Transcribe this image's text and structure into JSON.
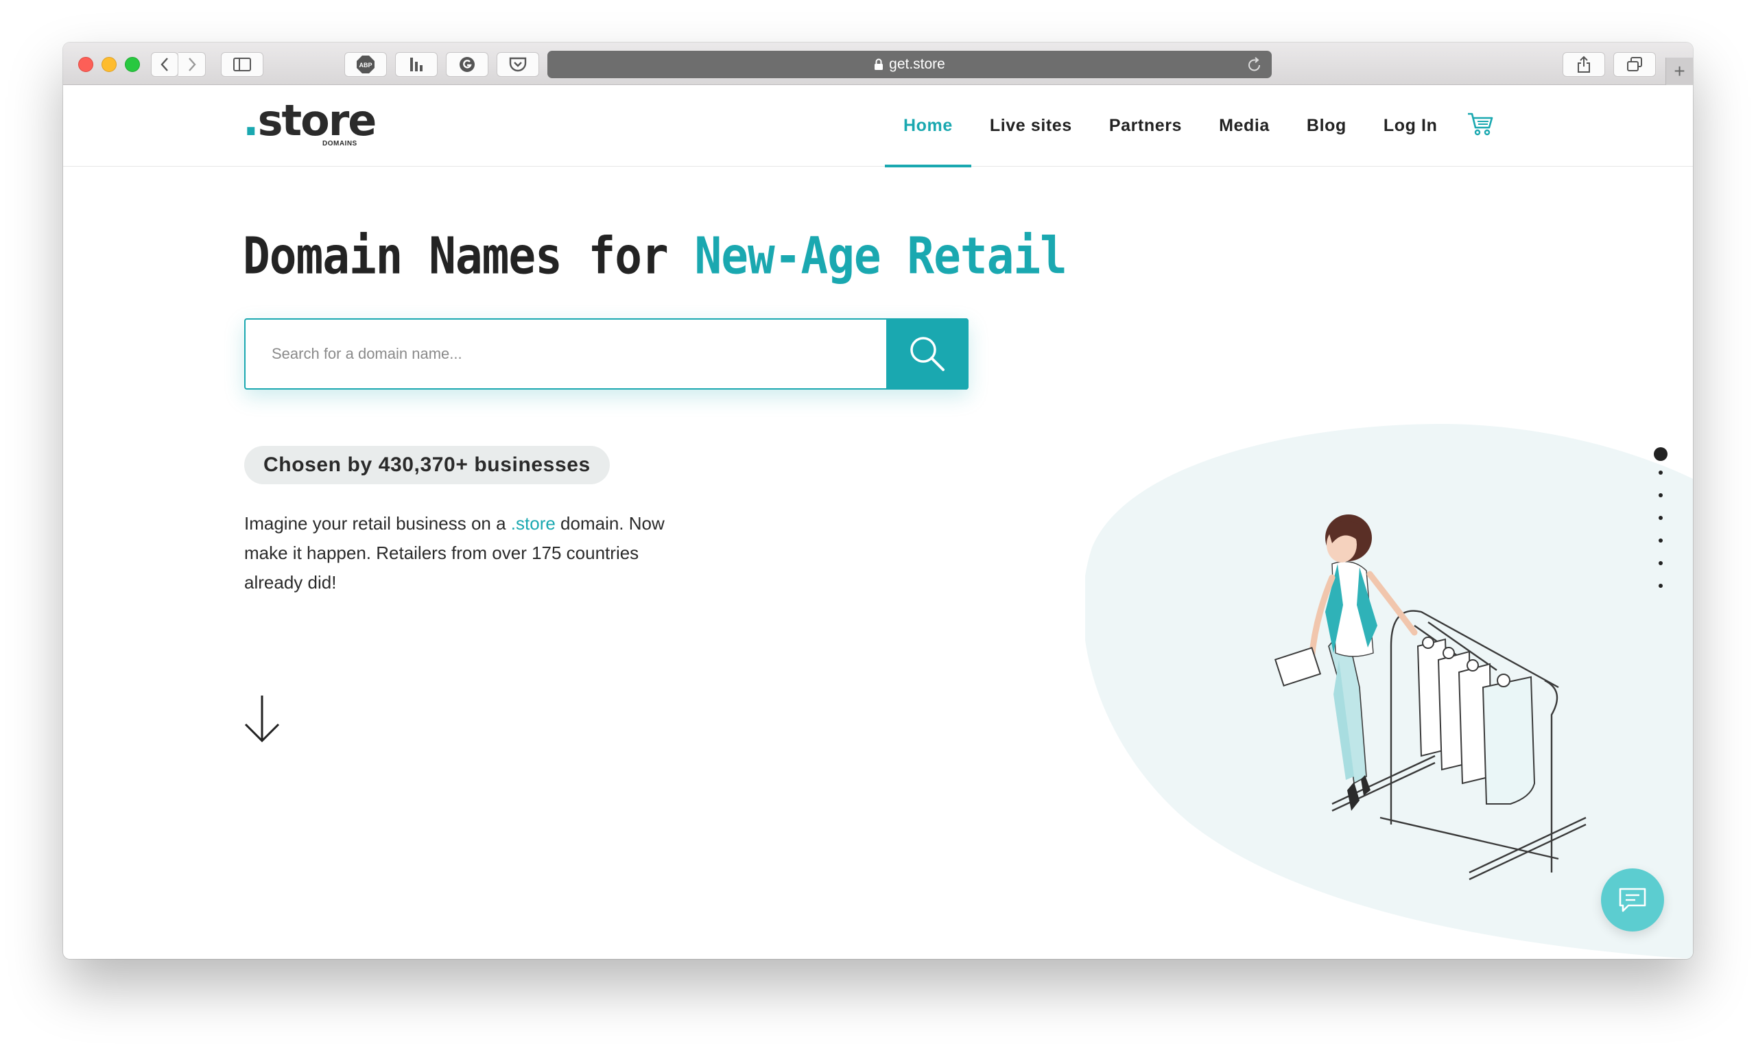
{
  "browser": {
    "url": "get.store",
    "icons": [
      "back-icon",
      "forward-icon",
      "sidebar-icon",
      "adblock-icon",
      "extension-icon",
      "grammarly-icon",
      "pocket-icon",
      "share-icon",
      "tabs-icon",
      "new-tab-icon"
    ],
    "adblock_label": "ABP",
    "new_tab_label": "+"
  },
  "site": {
    "logo": {
      "dot": ".",
      "text": "store",
      "sub": "DOMAINS"
    },
    "nav": [
      {
        "label": "Home",
        "active": true
      },
      {
        "label": "Live sites"
      },
      {
        "label": "Partners"
      },
      {
        "label": "Media"
      },
      {
        "label": "Blog"
      },
      {
        "label": "Log In"
      }
    ]
  },
  "hero": {
    "title_part1": "Domain Names for ",
    "title_part2": "New-Age Retail",
    "search_placeholder": "Search for a domain name...",
    "badge": "Chosen by 430,370+ businesses",
    "desc_part1": "Imagine your retail business on a ",
    "desc_link": ".store",
    "desc_part2": " domain. Now make it happen. Retailers from over 175 countries already did!"
  },
  "section_dots": {
    "count": 7,
    "active_index": 0
  },
  "colors": {
    "accent": "#1aa8b0",
    "chat": "#5ccdd0",
    "blob": "#eef6f7",
    "text": "#232323"
  }
}
